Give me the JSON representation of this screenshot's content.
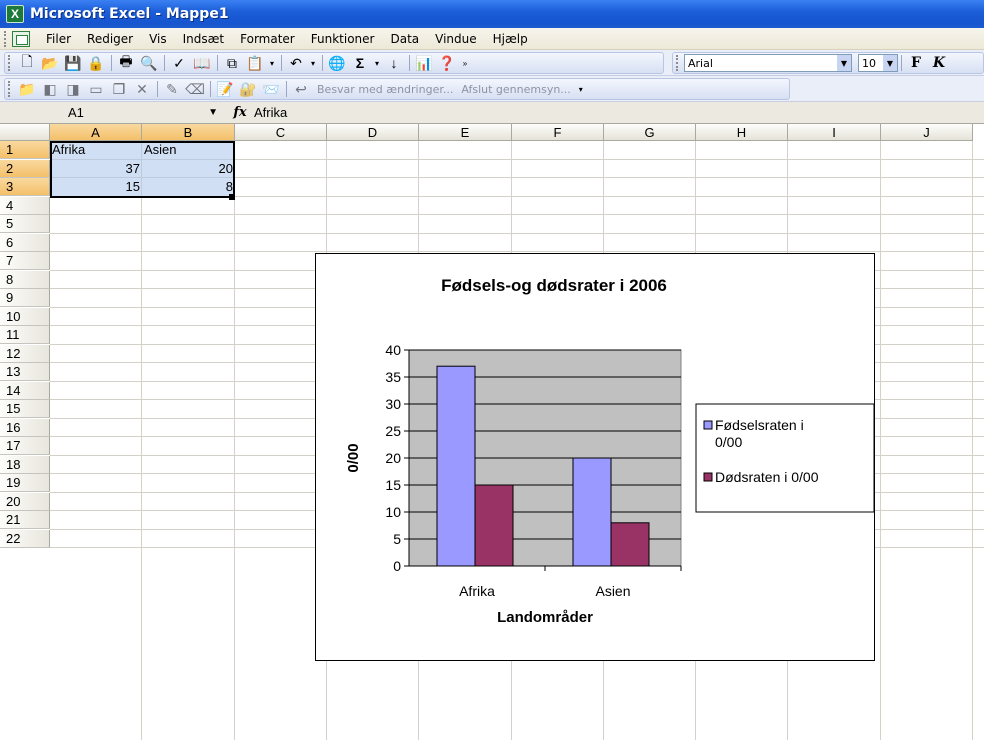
{
  "window": {
    "title": "Microsoft Excel - Mappe1"
  },
  "menu": [
    "Filer",
    "Rediger",
    "Vis",
    "Indsæt",
    "Formater",
    "Funktioner",
    "Data",
    "Vindue",
    "Hjælp"
  ],
  "toolbar": {
    "font_name": "Arial",
    "font_size": "10",
    "bold_label": "F",
    "review_reply": "Besvar med ændringer...",
    "review_end": "Afslut gennemsyn..."
  },
  "formula_bar": {
    "name_box": "A1",
    "fx": "fx",
    "content": "Afrika"
  },
  "columns": [
    "A",
    "B",
    "C",
    "D",
    "E",
    "F",
    "G",
    "H",
    "I",
    "J"
  ],
  "rows": [
    "1",
    "2",
    "3",
    "4",
    "5",
    "6",
    "7",
    "8",
    "9",
    "10",
    "11",
    "12",
    "13",
    "14",
    "15",
    "16",
    "17",
    "18",
    "19",
    "20",
    "21",
    "22"
  ],
  "cells": {
    "A1": "Afrika",
    "B1": "Asien",
    "A2": "37",
    "B2": "20",
    "A3": "15",
    "B3": "8"
  },
  "chart_data": {
    "type": "bar",
    "title": "Fødsels-og dødsrater i 2006",
    "xlabel": "Landområder",
    "ylabel": "0/00",
    "categories": [
      "Afrika",
      "Asien"
    ],
    "series": [
      {
        "name": "Fødselsraten i 0/00",
        "values": [
          37,
          20
        ],
        "color": "#9999ff"
      },
      {
        "name": "Dødsraten i 0/00",
        "values": [
          15,
          8
        ],
        "color": "#993366"
      }
    ],
    "ylim": [
      0,
      40
    ],
    "yticks": [
      "0",
      "5",
      "10",
      "15",
      "20",
      "25",
      "30",
      "35",
      "40"
    ],
    "plot_background": "#c0c0c0",
    "grid": true,
    "legend_position": "right"
  }
}
